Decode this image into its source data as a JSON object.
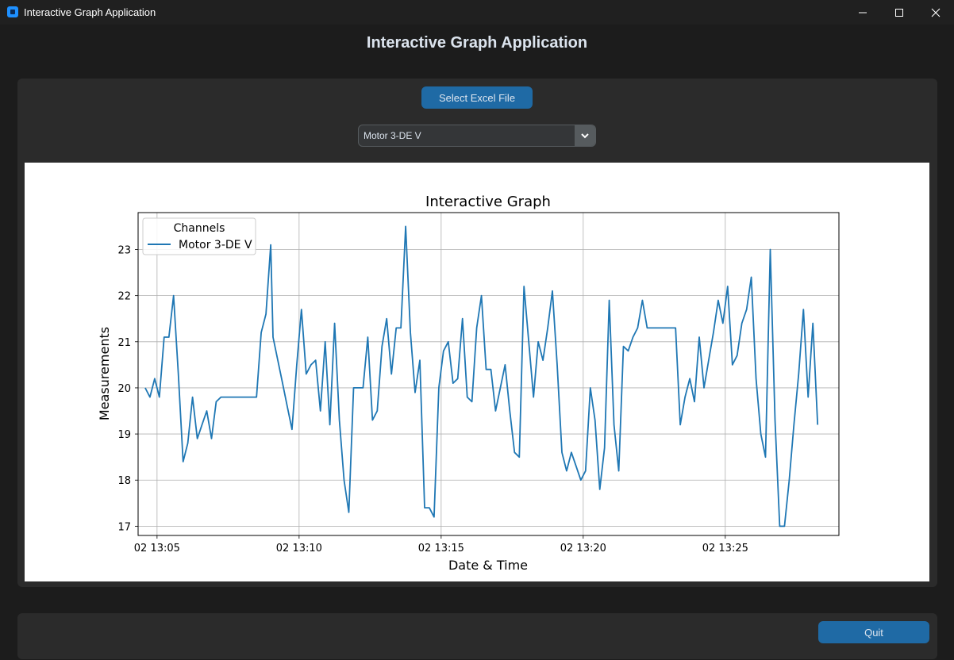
{
  "window": {
    "title": "Interactive Graph Application",
    "icon": "app-icon",
    "controls": [
      "minimize-icon",
      "maximize-icon",
      "close-icon"
    ]
  },
  "header": {
    "title": "Interactive Graph Application"
  },
  "toolbar": {
    "select_file_label": "Select Excel File",
    "channel_select": {
      "value": "Motor 3-DE V"
    }
  },
  "footer": {
    "quit_label": "Quit"
  },
  "colors": {
    "accent": "#1f6aa5",
    "series": "#1f77b4",
    "background": "#1c1c1c",
    "panel": "#2b2b2b"
  },
  "chart_data": {
    "type": "line",
    "title": "Interactive Graph",
    "xlabel": "Date & Time",
    "ylabel": "Measurements",
    "legend": {
      "title": "Channels",
      "position": "top-left"
    },
    "grid": true,
    "x_range": [
      "02 13:04:20",
      "02 13:29:00"
    ],
    "y_range": [
      16.8,
      23.8
    ],
    "x_ticks": [
      "02 13:05",
      "02 13:10",
      "02 13:15",
      "02 13:20",
      "02 13:25"
    ],
    "y_ticks": [
      "17",
      "18",
      "19",
      "20",
      "21",
      "22",
      "23"
    ],
    "series": [
      {
        "name": "Motor 3-DE V",
        "color": "#1f77b4",
        "points": [
          [
            "02 13:04:35",
            20.0
          ],
          [
            "02 13:04:45",
            19.8
          ],
          [
            "02 13:04:55",
            20.2
          ],
          [
            "02 13:05:05",
            19.8
          ],
          [
            "02 13:05:15",
            21.1
          ],
          [
            "02 13:05:25",
            21.1
          ],
          [
            "02 13:05:35",
            22.0
          ],
          [
            "02 13:05:45",
            20.3
          ],
          [
            "02 13:05:55",
            18.4
          ],
          [
            "02 13:06:05",
            18.8
          ],
          [
            "02 13:06:15",
            19.8
          ],
          [
            "02 13:06:25",
            18.9
          ],
          [
            "02 13:06:35",
            19.2
          ],
          [
            "02 13:06:45",
            19.5
          ],
          [
            "02 13:06:55",
            18.9
          ],
          [
            "02 13:07:05",
            19.7
          ],
          [
            "02 13:07:15",
            19.8
          ],
          [
            "02 13:08:30",
            19.8
          ],
          [
            "02 13:08:40",
            21.2
          ],
          [
            "02 13:08:50",
            21.6
          ],
          [
            "02 13:09:00",
            23.1
          ],
          [
            "02 13:09:05",
            21.1
          ],
          [
            "02 13:09:25",
            20.1
          ],
          [
            "02 13:09:35",
            19.6
          ],
          [
            "02 13:09:45",
            19.1
          ],
          [
            "02 13:09:55",
            20.5
          ],
          [
            "02 13:10:05",
            21.7
          ],
          [
            "02 13:10:15",
            20.3
          ],
          [
            "02 13:10:25",
            20.5
          ],
          [
            "02 13:10:35",
            20.6
          ],
          [
            "02 13:10:45",
            19.5
          ],
          [
            "02 13:10:55",
            21.0
          ],
          [
            "02 13:11:05",
            19.2
          ],
          [
            "02 13:11:15",
            21.4
          ],
          [
            "02 13:11:25",
            19.3
          ],
          [
            "02 13:11:35",
            18.0
          ],
          [
            "02 13:11:45",
            17.3
          ],
          [
            "02 13:11:55",
            20.0
          ],
          [
            "02 13:12:05",
            20.0
          ],
          [
            "02 13:12:15",
            20.0
          ],
          [
            "02 13:12:25",
            21.1
          ],
          [
            "02 13:12:35",
            19.3
          ],
          [
            "02 13:12:45",
            19.5
          ],
          [
            "02 13:12:55",
            20.9
          ],
          [
            "02 13:13:05",
            21.5
          ],
          [
            "02 13:13:15",
            20.3
          ],
          [
            "02 13:13:25",
            21.3
          ],
          [
            "02 13:13:35",
            21.3
          ],
          [
            "02 13:13:45",
            23.5
          ],
          [
            "02 13:13:55",
            21.2
          ],
          [
            "02 13:14:05",
            19.9
          ],
          [
            "02 13:14:15",
            20.6
          ],
          [
            "02 13:14:25",
            17.4
          ],
          [
            "02 13:14:35",
            17.4
          ],
          [
            "02 13:14:45",
            17.2
          ],
          [
            "02 13:14:55",
            20.0
          ],
          [
            "02 13:15:05",
            20.8
          ],
          [
            "02 13:15:15",
            21.0
          ],
          [
            "02 13:15:25",
            20.1
          ],
          [
            "02 13:15:35",
            20.2
          ],
          [
            "02 13:15:45",
            21.5
          ],
          [
            "02 13:15:55",
            19.8
          ],
          [
            "02 13:16:05",
            19.7
          ],
          [
            "02 13:16:15",
            21.3
          ],
          [
            "02 13:16:25",
            22.0
          ],
          [
            "02 13:16:35",
            20.4
          ],
          [
            "02 13:16:45",
            20.4
          ],
          [
            "02 13:16:55",
            19.5
          ],
          [
            "02 13:17:05",
            20.0
          ],
          [
            "02 13:17:15",
            20.5
          ],
          [
            "02 13:17:25",
            19.5
          ],
          [
            "02 13:17:35",
            18.6
          ],
          [
            "02 13:17:45",
            18.5
          ],
          [
            "02 13:17:55",
            22.2
          ],
          [
            "02 13:18:05",
            21.0
          ],
          [
            "02 13:18:15",
            19.8
          ],
          [
            "02 13:18:25",
            21.0
          ],
          [
            "02 13:18:35",
            20.6
          ],
          [
            "02 13:18:45",
            21.3
          ],
          [
            "02 13:18:55",
            22.1
          ],
          [
            "02 13:19:05",
            20.5
          ],
          [
            "02 13:19:15",
            18.6
          ],
          [
            "02 13:19:25",
            18.2
          ],
          [
            "02 13:19:35",
            18.6
          ],
          [
            "02 13:19:45",
            18.3
          ],
          [
            "02 13:19:55",
            18.0
          ],
          [
            "02 13:20:05",
            18.2
          ],
          [
            "02 13:20:15",
            20.0
          ],
          [
            "02 13:20:25",
            19.3
          ],
          [
            "02 13:20:35",
            17.8
          ],
          [
            "02 13:20:45",
            18.7
          ],
          [
            "02 13:20:55",
            21.9
          ],
          [
            "02 13:21:05",
            19.2
          ],
          [
            "02 13:21:15",
            18.2
          ],
          [
            "02 13:21:25",
            20.9
          ],
          [
            "02 13:21:35",
            20.8
          ],
          [
            "02 13:21:45",
            21.1
          ],
          [
            "02 13:21:55",
            21.3
          ],
          [
            "02 13:22:05",
            21.9
          ],
          [
            "02 13:22:15",
            21.3
          ],
          [
            "02 13:23:15",
            21.3
          ],
          [
            "02 13:23:25",
            19.2
          ],
          [
            "02 13:23:35",
            19.8
          ],
          [
            "02 13:23:45",
            20.2
          ],
          [
            "02 13:23:55",
            19.7
          ],
          [
            "02 13:24:05",
            21.1
          ],
          [
            "02 13:24:15",
            20.0
          ],
          [
            "02 13:24:25",
            20.6
          ],
          [
            "02 13:24:35",
            21.2
          ],
          [
            "02 13:24:45",
            21.9
          ],
          [
            "02 13:24:55",
            21.4
          ],
          [
            "02 13:25:05",
            22.2
          ],
          [
            "02 13:25:15",
            20.5
          ],
          [
            "02 13:25:25",
            20.7
          ],
          [
            "02 13:25:35",
            21.4
          ],
          [
            "02 13:25:45",
            21.7
          ],
          [
            "02 13:25:55",
            22.4
          ],
          [
            "02 13:26:05",
            20.2
          ],
          [
            "02 13:26:15",
            19.0
          ],
          [
            "02 13:26:25",
            18.5
          ],
          [
            "02 13:26:35",
            23.0
          ],
          [
            "02 13:26:45",
            19.3
          ],
          [
            "02 13:26:55",
            17.0
          ],
          [
            "02 13:27:05",
            17.0
          ],
          [
            "02 13:27:15",
            18.0
          ],
          [
            "02 13:27:25",
            19.2
          ],
          [
            "02 13:27:35",
            20.3
          ],
          [
            "02 13:27:45",
            21.7
          ],
          [
            "02 13:27:55",
            19.8
          ],
          [
            "02 13:28:05",
            21.4
          ],
          [
            "02 13:28:15",
            19.2
          ]
        ]
      }
    ]
  }
}
